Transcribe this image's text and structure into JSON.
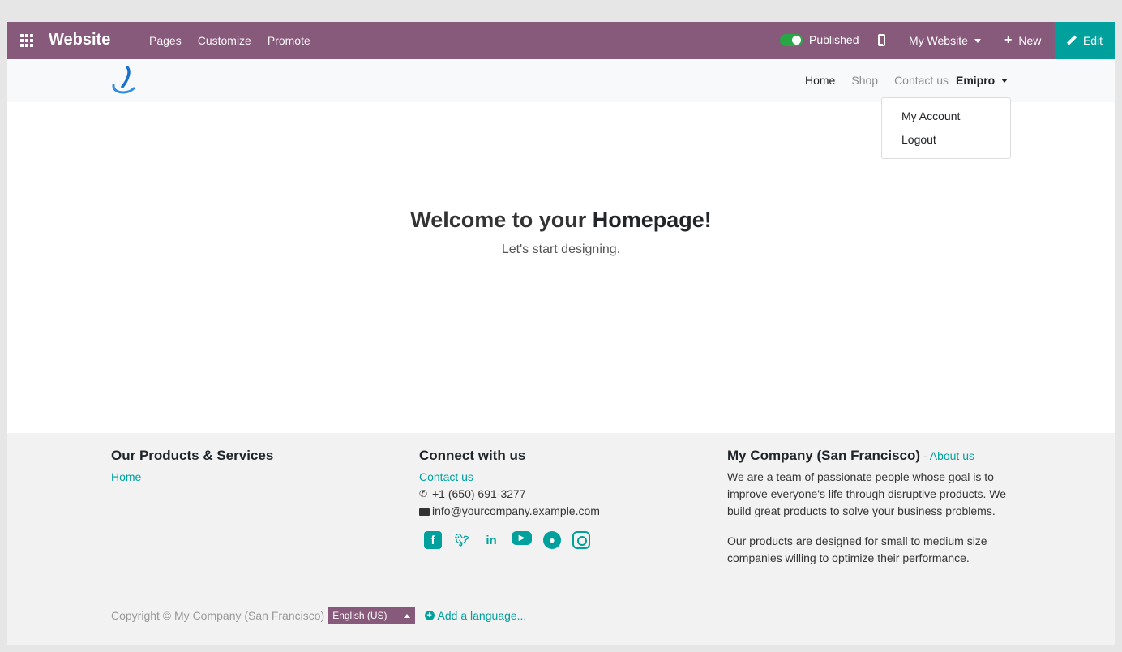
{
  "topbar": {
    "app_title": "Website",
    "menu": [
      "Pages",
      "Customize",
      "Promote"
    ],
    "published_label": "Published",
    "my_website_label": "My Website",
    "new_label": "New",
    "edit_label": "Edit"
  },
  "site": {
    "nav": {
      "home": "Home",
      "shop": "Shop",
      "contact": "Contact us"
    },
    "user_label": "Emipro",
    "dropdown": {
      "my_account": "My Account",
      "logout": "Logout"
    }
  },
  "hero": {
    "title_prefix": "Welcome to your ",
    "title_bold": "Homepage",
    "title_suffix": "!",
    "subtitle": "Let's start designing."
  },
  "footer": {
    "col1": {
      "heading": "Our Products & Services",
      "link": "Home"
    },
    "col2": {
      "heading": "Connect with us",
      "contact_link": "Contact us",
      "phone": "+1 (650) 691-3277",
      "email": "info@yourcompany.example.com",
      "social": [
        "facebook-icon",
        "twitter-icon",
        "linkedin-icon",
        "youtube-icon",
        "github-icon",
        "instagram-icon"
      ]
    },
    "col3": {
      "heading": "My Company (San Francisco)",
      "separator": " - ",
      "about_link": "About us",
      "para1": "We are a team of passionate people whose goal is to improve everyone's life through disruptive products. We build great products to solve your business problems.",
      "para2": "Our products are designed for small to medium size companies willing to optimize their performance."
    },
    "copyright": "Copyright © My Company (San Francisco)",
    "language": "English (US)",
    "add_language": "Add a language..."
  },
  "colors": {
    "topbar": "#875a7b",
    "accent": "#00a09d",
    "toggle": "#28a745"
  }
}
